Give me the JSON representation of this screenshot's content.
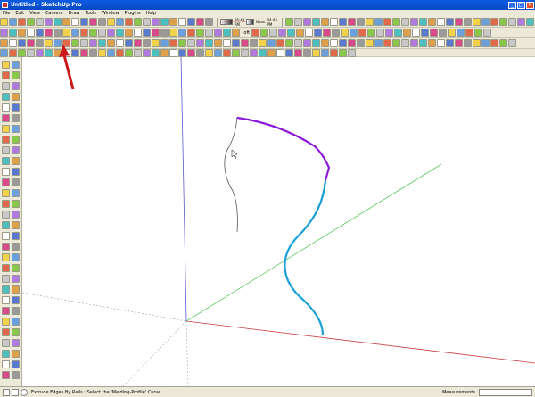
{
  "window": {
    "title": "Untitled - SketchUp Pro",
    "controls": {
      "minimize": "_",
      "maximize": "□",
      "close": "×"
    }
  },
  "menu": [
    "File",
    "Edit",
    "View",
    "Camera",
    "Draw",
    "Tools",
    "Window",
    "Plugins",
    "Help"
  ],
  "toolbar_row1": {
    "shadow_months": "J F M A M J J A S O N D",
    "shadow_time_left": "06:43 AM",
    "shadow_time_mid": "Noon",
    "shadow_time_right": "04:46 PM"
  },
  "toolbar_row2": {
    "loft_label": "loft"
  },
  "annotation": {
    "color": "#cc1a1a",
    "meaning": "arrow-pointing-to-extrude-by-rails-tool"
  },
  "curves": {
    "profile_color": "#8a1ad8",
    "rail_color": "#1aa0d8",
    "thin_color": "#555555"
  },
  "axes": {
    "red": "#c83c3c",
    "green": "#5cc85c",
    "blue": "#5a5ad0"
  },
  "status": {
    "text": "Extrude Edges By Rails : Select the 'Melding-Profile' Curve...",
    "measurements_label": "Measurements"
  }
}
